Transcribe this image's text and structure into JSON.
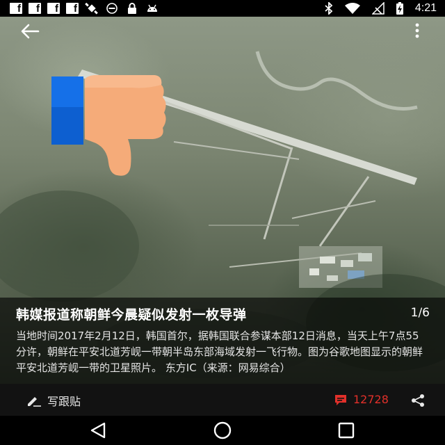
{
  "status_bar": {
    "time": "4:21",
    "left_icons": [
      "facebook-icon",
      "facebook-icon",
      "facebook-icon",
      "facebook-icon",
      "satellite-icon",
      "recent-icon",
      "lock-icon",
      "android-icon"
    ],
    "right_icons": [
      "bluetooth-icon",
      "wifi-icon",
      "no-signal-icon",
      "battery-charging-icon"
    ]
  },
  "top_bar": {
    "back_icon": "arrow-left-icon",
    "more_icon": "more-vertical-icon"
  },
  "photo": {
    "overlay_icon": "thumbs-down-icon"
  },
  "caption": {
    "title": "韩媒报道称朝鲜今晨疑似发射一枚导弹",
    "counter": "1/6",
    "body": "当地时间2017年2月12日，韩国首尔，据韩国联合参谋本部12日消息，当天上午7点55分许，朝鲜在平安北道芳岘一带朝半岛东部海域发射一飞行物。图为谷歌地图显示的朝鲜平安北道芳岘一带的卫星照片。  东方IC（来源：网易综合）"
  },
  "bottom_bar": {
    "write_label": "写跟贴",
    "comment_count": "12728",
    "comment_color": "#e2302a"
  },
  "nav_bar": {
    "buttons": [
      "back-triangle-icon",
      "home-circle-icon",
      "recents-square-icon"
    ]
  }
}
